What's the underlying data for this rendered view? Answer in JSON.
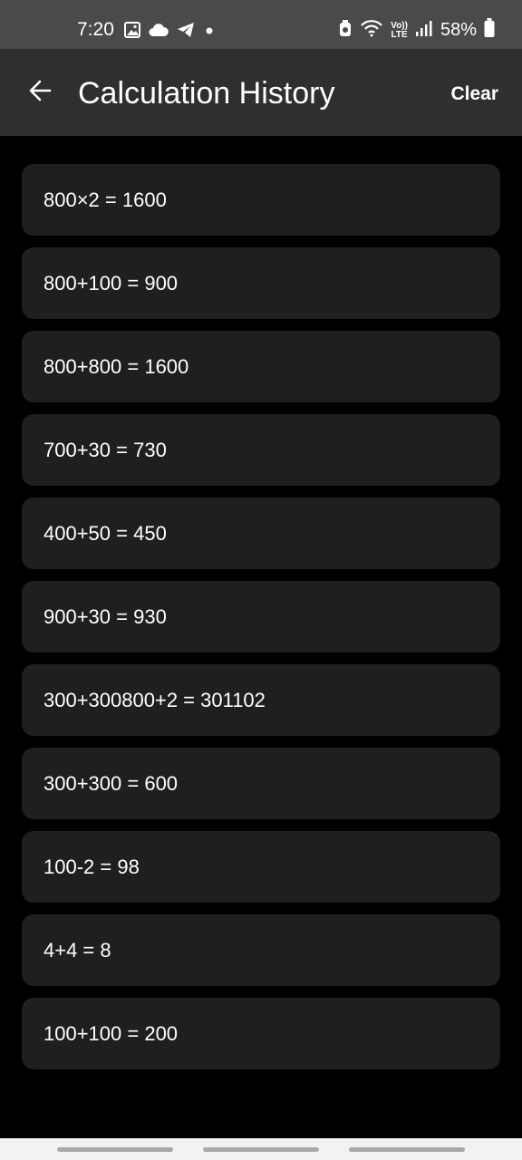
{
  "status_bar": {
    "time": "7:20",
    "battery": "58%",
    "network_label_top": "Vo))",
    "network_label_bottom": "LTE",
    "icons": [
      "image-icon",
      "cloud-icon",
      "telegram-icon",
      "dot-icon",
      "alarm-icon",
      "wifi-icon",
      "volte-icon",
      "signal-icon",
      "battery-icon"
    ]
  },
  "app_bar": {
    "title": "Calculation History",
    "clear_label": "Clear",
    "back_icon": "arrow-left-icon"
  },
  "history": [
    "800×2 = 1600",
    "800+100 = 900",
    "800+800 = 1600",
    "700+30 = 730",
    "400+50 = 450",
    "900+30 = 930",
    "300+300800+2 = 301102",
    "300+300 = 600",
    "100-2 = 98",
    "4+4 = 8",
    "100+100 = 200"
  ],
  "colors": {
    "status_bar_bg": "#4a4a4a",
    "app_bar_bg": "#2f2f2f",
    "page_bg": "#000000",
    "card_bg": "#1f1f1f",
    "text": "#ffffff"
  }
}
